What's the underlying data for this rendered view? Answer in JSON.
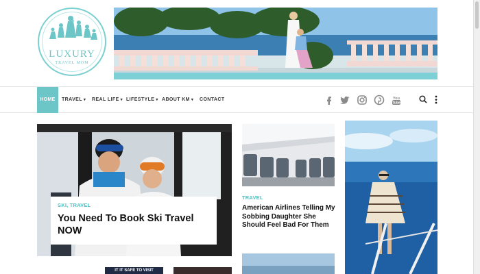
{
  "brand": {
    "logo_title": "LUXURY",
    "logo_subtitle": "TRAVEL MOM",
    "accent_color": "#6cc6c8"
  },
  "nav": {
    "items": [
      {
        "label": "HOME",
        "active": true
      },
      {
        "label": "TRAVEL",
        "has_dropdown": true
      },
      {
        "label": "REAL LIFE",
        "has_dropdown": true
      },
      {
        "label": "LIFESTYLE",
        "has_dropdown": true
      },
      {
        "label": "ABOUT KM",
        "has_dropdown": true
      },
      {
        "label": "CONTACT",
        "has_dropdown": false
      }
    ],
    "caret": "▾",
    "social_icons": [
      "facebook-icon",
      "twitter-icon",
      "instagram-icon",
      "pinterest-icon",
      "youtube-icon"
    ],
    "search_icon": "search-icon",
    "more_icon": "more-vertical-icon"
  },
  "featured": {
    "category": "SKI, TRAVEL",
    "title": "You Need To Book Ski Travel NOW"
  },
  "article2": {
    "category": "TRAVEL",
    "title": "American Airlines Telling My Sobbing Daughter She Should Feel Bad For Them"
  },
  "thumb1": {
    "text": "IT IT SAFE TO VISIT"
  }
}
